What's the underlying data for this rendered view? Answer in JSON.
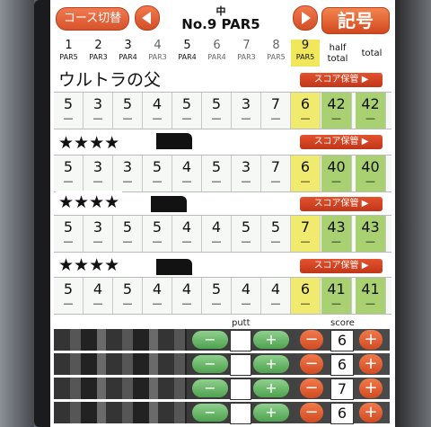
{
  "topbar": {
    "course_button": "コース切替",
    "hole_subtitle": "中",
    "hole_title": "No.9 PAR5",
    "kigo_button": "記号"
  },
  "header": {
    "holes": [
      {
        "n": "1",
        "par": "PAR5"
      },
      {
        "n": "2",
        "par": "PAR3"
      },
      {
        "n": "3",
        "par": "PAR4"
      },
      {
        "n": "4",
        "par": "PAR3"
      },
      {
        "n": "5",
        "par": "PAR4"
      },
      {
        "n": "6",
        "par": "PAR4"
      },
      {
        "n": "7",
        "par": "PAR3"
      },
      {
        "n": "8",
        "par": "PAR5"
      },
      {
        "n": "9",
        "par": "PAR5"
      }
    ],
    "half_label": "half\ntotal",
    "half_l1": "half",
    "half_l2": "total",
    "total_label": "total"
  },
  "players": [
    {
      "name": "ウルトラの父",
      "save": "スコア保管 ▶",
      "scores": [
        "5",
        "3",
        "5",
        "4",
        "5",
        "5",
        "3",
        "7",
        "6"
      ],
      "half": "42",
      "total": "42"
    },
    {
      "name": "★★★★",
      "save": "スコア保管 ▶",
      "scores": [
        "5",
        "3",
        "3",
        "5",
        "4",
        "5",
        "3",
        "7",
        "6"
      ],
      "half": "40",
      "total": "40"
    },
    {
      "name": "★★★★",
      "save": "スコア保管 ▶",
      "scores": [
        "5",
        "3",
        "5",
        "5",
        "4",
        "4",
        "5",
        "5",
        "7"
      ],
      "half": "43",
      "total": "43"
    },
    {
      "name": "★★★★",
      "save": "スコア保管 ▶",
      "scores": [
        "5",
        "4",
        "5",
        "4",
        "4",
        "5",
        "4",
        "4",
        "6"
      ],
      "half": "41",
      "total": "41"
    }
  ],
  "dash": "—",
  "controls": {
    "putt_label": "putt",
    "score_label": "score",
    "minus": "−",
    "plus": "+",
    "rows": [
      {
        "putt": "",
        "score": "6"
      },
      {
        "putt": "",
        "score": "6"
      },
      {
        "putt": "",
        "score": "7"
      },
      {
        "putt": "",
        "score": "6"
      }
    ]
  },
  "colors": {
    "accent": "#d8532c",
    "current_hole": "#f0ea6e",
    "sum": "#a9d071",
    "putt_button": "#5aa95a"
  }
}
